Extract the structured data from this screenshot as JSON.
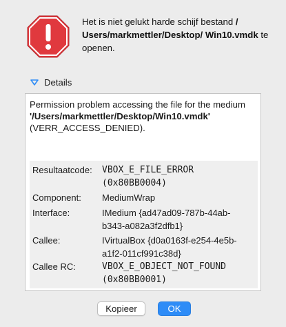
{
  "dialog": {
    "message_part1": "Het is niet gelukt harde schijf bestand ",
    "message_path": "/ Users/markmettler/Desktop/ Win10.vmdk",
    "message_part2": " te openen."
  },
  "details": {
    "toggle_label": "Details",
    "text_before": "Permission problem accessing the file for the medium ",
    "text_path": "'/Users/markmettler/Desktop/Win10.vmdk'",
    "text_after": " (VERR_ACCESS_DENIED).",
    "rows": [
      {
        "label": "Resultaatcode:",
        "value_line1": "VBOX_E_FILE_ERROR",
        "value_line2": "(0x80BB0004)"
      },
      {
        "label": "Component:",
        "value_line1": "MediumWrap"
      },
      {
        "label": "Interface:",
        "value_line1": "IMedium {ad47ad09-787b-44ab-",
        "value_line2": "b343-a082a3f2dfb1}"
      },
      {
        "label": "Callee:",
        "value_line1": "IVirtualBox {d0a0163f-e254-4e5b-",
        "value_line2": "a1f2-011cf991c38d}"
      },
      {
        "label": "Callee RC:",
        "value_line1": "VBOX_E_OBJECT_NOT_FOUND",
        "value_line2": "(0x80BB0001)"
      }
    ]
  },
  "buttons": {
    "copy_label": "Kopieer",
    "ok_label": "OK"
  },
  "icons": {
    "alert": "stop-sign-icon",
    "disclosure": "disclosure-triangle-down-icon"
  },
  "colors": {
    "stop_red": "#e0393e",
    "accent_blue": "#2e8cf7"
  }
}
